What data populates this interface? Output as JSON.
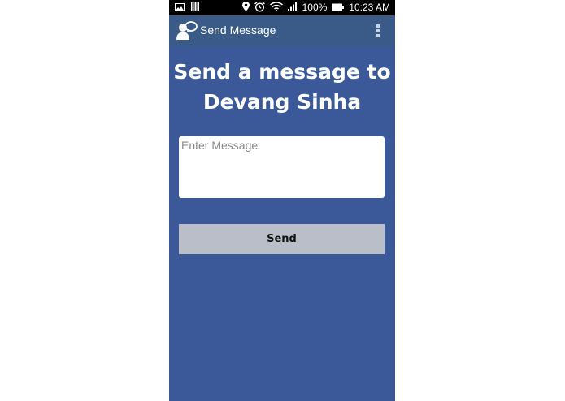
{
  "status_bar": {
    "battery_percent": "100%",
    "time": "10:23 AM",
    "icons": [
      "gallery-icon",
      "barcode-icon",
      "location-icon",
      "alarm-icon",
      "wifi-icon",
      "signal-icon",
      "battery-icon"
    ]
  },
  "action_bar": {
    "title": "Send Message",
    "icon": "chat-person-icon",
    "menu_icon": "overflow-menu-icon"
  },
  "main": {
    "heading_line1": "Send a message to",
    "heading_line2": "Devang Sinha",
    "message_placeholder": "Enter Message",
    "message_value": "",
    "send_label": "Send"
  },
  "colors": {
    "background": "#3b5998",
    "action_bar": "#3a5b87",
    "button": "#b9bec8",
    "status_bar": "#000000"
  }
}
